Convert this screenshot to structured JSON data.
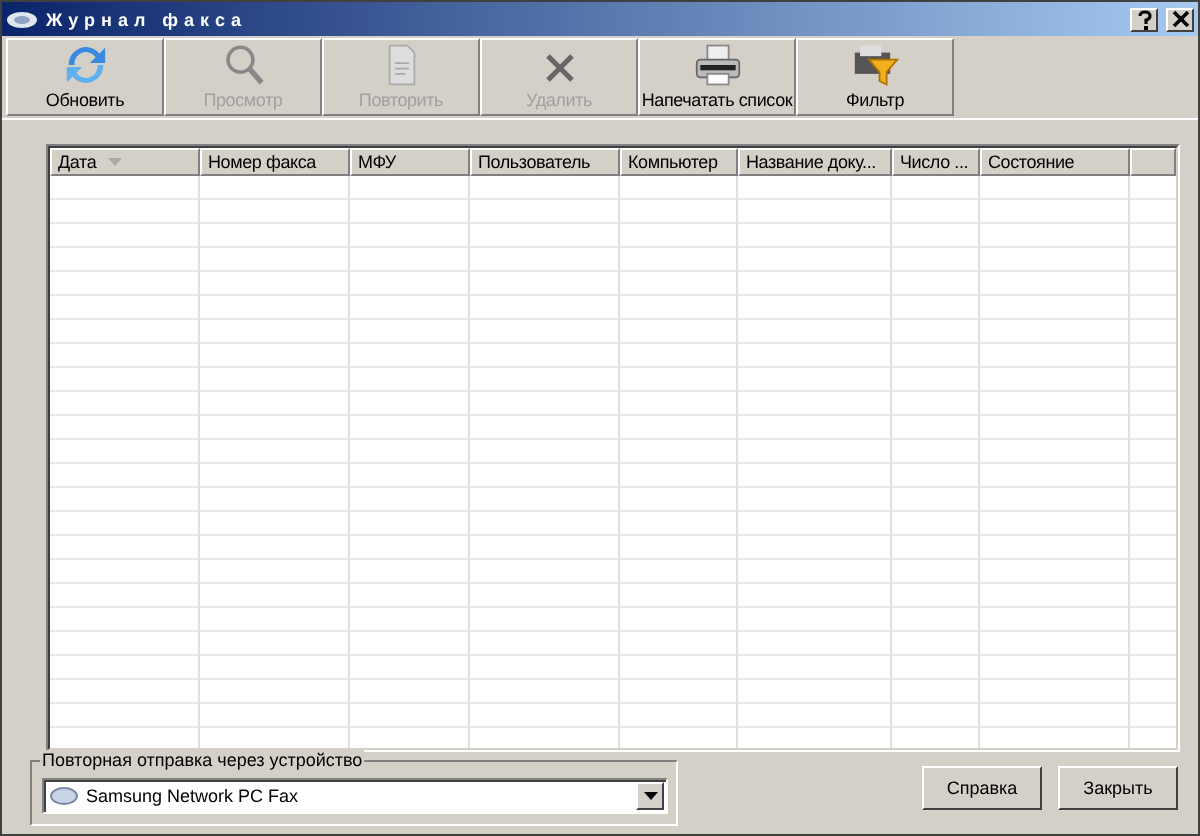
{
  "window": {
    "title": "Журнал факса"
  },
  "toolbar": [
    {
      "label": "Обновить",
      "kind": "refresh",
      "disabled": false
    },
    {
      "label": "Просмотр",
      "kind": "view",
      "disabled": true
    },
    {
      "label": "Повторить",
      "kind": "resend",
      "disabled": true
    },
    {
      "label": "Удалить",
      "kind": "delete",
      "disabled": true
    },
    {
      "label": "Напечатать список",
      "kind": "print",
      "disabled": false
    },
    {
      "label": "Фильтр",
      "kind": "filter",
      "disabled": false
    }
  ],
  "table": {
    "columns": [
      "Дата",
      "Номер факса",
      "МФУ",
      "Пользователь",
      "Компьютер",
      "Название доку...",
      "Число ...",
      "Состояние"
    ]
  },
  "resend_group": {
    "label": "Повторная отправка через устройство",
    "device": "Samsung Network PC Fax"
  },
  "buttons": [
    "Справка",
    "Закрыть"
  ]
}
